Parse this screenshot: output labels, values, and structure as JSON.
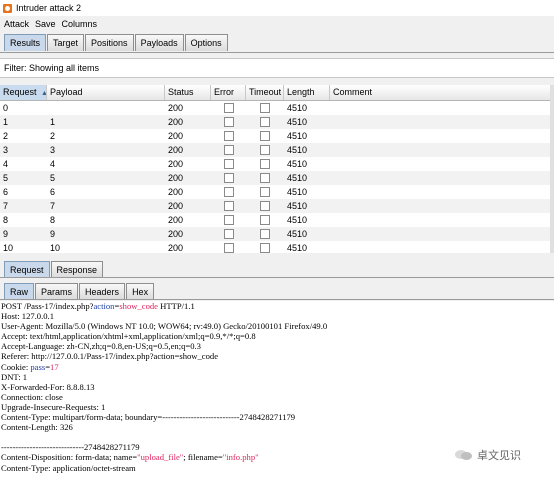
{
  "window": {
    "title": "Intruder attack 2"
  },
  "menu": [
    "Attack",
    "Save",
    "Columns"
  ],
  "tabs": [
    "Results",
    "Target",
    "Positions",
    "Payloads",
    "Options"
  ],
  "filter": "Filter: Showing all items",
  "table": {
    "columns": [
      "Request",
      "Payload",
      "Status",
      "Error",
      "Timeout",
      "Length",
      "Comment"
    ],
    "rows": [
      {
        "request": "0",
        "payload": "",
        "status": "200",
        "length": "4510"
      },
      {
        "request": "1",
        "payload": "1",
        "status": "200",
        "length": "4510"
      },
      {
        "request": "2",
        "payload": "2",
        "status": "200",
        "length": "4510"
      },
      {
        "request": "3",
        "payload": "3",
        "status": "200",
        "length": "4510"
      },
      {
        "request": "4",
        "payload": "4",
        "status": "200",
        "length": "4510"
      },
      {
        "request": "5",
        "payload": "5",
        "status": "200",
        "length": "4510"
      },
      {
        "request": "6",
        "payload": "6",
        "status": "200",
        "length": "4510"
      },
      {
        "request": "7",
        "payload": "7",
        "status": "200",
        "length": "4510"
      },
      {
        "request": "8",
        "payload": "8",
        "status": "200",
        "length": "4510"
      },
      {
        "request": "9",
        "payload": "9",
        "status": "200",
        "length": "4510"
      },
      {
        "request": "10",
        "payload": "10",
        "status": "200",
        "length": "4510"
      }
    ]
  },
  "detail_tabs": [
    "Request",
    "Response"
  ],
  "view_tabs": [
    "Raw",
    "Params",
    "Headers",
    "Hex"
  ],
  "request_lines": [
    [
      {
        "t": "POST /Pass-17/index.php?"
      },
      {
        "t": "action",
        "c": "blue"
      },
      {
        "t": "="
      },
      {
        "t": "show_code",
        "c": "hl"
      },
      {
        "t": " HTTP/1.1"
      }
    ],
    [
      {
        "t": "Host: 127.0.0.1"
      }
    ],
    [
      {
        "t": "User-Agent: Mozilla/5.0 (Windows NT 10.0; WOW64; rv:49.0) Gecko/20100101 Firefox/49.0"
      }
    ],
    [
      {
        "t": "Accept: text/html,application/xhtml+xml,application/xml;q=0.9,*/*;q=0.8"
      }
    ],
    [
      {
        "t": "Accept-Language: zh-CN,zh;q=0.8,en-US;q=0.5,en;q=0.3"
      }
    ],
    [
      {
        "t": "Referer: http://127.0.0.1/Pass-17/index.php?action=show_code"
      }
    ],
    [
      {
        "t": "Cookie: "
      },
      {
        "t": "pass",
        "c": "blue"
      },
      {
        "t": "="
      },
      {
        "t": "17",
        "c": "hl"
      }
    ],
    [
      {
        "t": "DNT: 1"
      }
    ],
    [
      {
        "t": "X-Forwarded-For: 8.8.8.13"
      }
    ],
    [
      {
        "t": "Connection: close"
      }
    ],
    [
      {
        "t": "Upgrade-Insecure-Requests: 1"
      }
    ],
    [
      {
        "t": "Content-Type: multipart/form-data; boundary=---------------------------2748428271179"
      }
    ],
    [
      {
        "t": "Content-Length: 326"
      }
    ],
    [
      {
        "t": ""
      }
    ],
    [
      {
        "t": "-----------------------------2748428271179"
      }
    ],
    [
      {
        "t": "Content-Disposition: form-data; name="
      },
      {
        "t": "\"upload_file\"",
        "c": "hl"
      },
      {
        "t": "; filename="
      },
      {
        "t": "\"info.php\"",
        "c": "hl"
      }
    ],
    [
      {
        "t": "Content-Type: application/octet-stream"
      }
    ]
  ],
  "watermark": "卓文见识"
}
